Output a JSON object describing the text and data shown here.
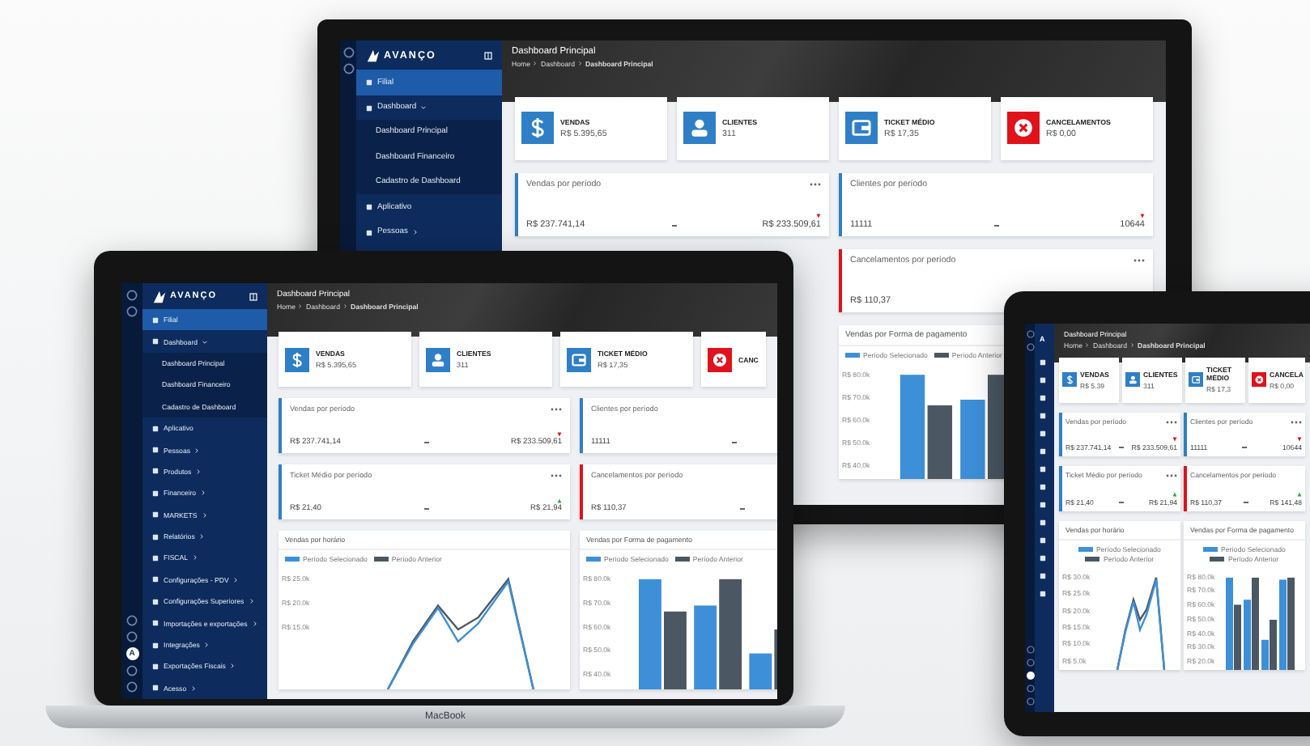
{
  "monitor": {
    "logo": "AVANÇO",
    "sidebar": [
      {
        "label": "Filial",
        "selected": true
      },
      {
        "label": "Dashboard",
        "selected": false,
        "expanded": true,
        "children": [
          {
            "label": "Dashboard Principal",
            "selected": false
          },
          {
            "label": "Dashboard Financeiro",
            "selected": false
          },
          {
            "label": "Cadastro de Dashboard",
            "selected": false
          }
        ]
      },
      {
        "label": "Aplicativo",
        "selected": false
      },
      {
        "label": "Pessoas",
        "selected": false,
        "expanded": false
      }
    ],
    "header": {
      "title": "Dashboard Principal",
      "breadcrumb": [
        "Home",
        "Dashboard",
        "Dashboard Principal"
      ]
    },
    "stats": [
      {
        "kind": "money",
        "title": "VENDAS",
        "value": "R$ 5.395,65"
      },
      {
        "kind": "user",
        "title": "CLIENTES",
        "value": "311"
      },
      {
        "kind": "wallet",
        "title": "TICKET MÉDIO",
        "value": "R$ 17,35"
      },
      {
        "kind": "cancel",
        "title": "CANCELAMENTOS",
        "value": "R$ 0,00"
      }
    ],
    "periods": [
      {
        "title": "Vendas por período",
        "color": "#2f7fc6",
        "menu": true,
        "current": {
          "value": "R$ 237.741,14"
        },
        "previous": {
          "value": "R$ 233.509,61",
          "rising": false
        }
      },
      {
        "title": "Clientes por período",
        "color": "#2f7fc6",
        "menu": false,
        "current": {
          "value": "11111"
        },
        "previous": {
          "value": "10644",
          "rising": false
        }
      }
    ],
    "right_column": {
      "periods": [
        {
          "title": "Cancelamentos por período",
          "color": "#e0121b",
          "menu": true,
          "current": {
            "value": "R$ 110,37"
          }
        }
      ],
      "charts": [
        {
          "title": "Vendas por Forma de pagamento",
          "kind": "bar",
          "legend": [
            {
              "label": "Período Selecionado",
              "color": "#3d8fd8"
            },
            {
              "label": "Período Anterior",
              "color": "#4b5863"
            }
          ],
          "y_axis_labels": [
            "R$ 80.0k",
            "R$ 70.0k",
            "R$ 60.0k",
            "R$ 50.0k",
            "R$ 40.0k"
          ]
        }
      ]
    }
  },
  "laptop": {
    "logo": "AVANÇO",
    "avatar_letter": "A",
    "brand": "MacBook",
    "sidebar": [
      {
        "label": "Filial",
        "selected": true
      },
      {
        "label": "Dashboard",
        "selected": false,
        "expanded": true,
        "children": [
          {
            "label": "Dashboard Principal",
            "selected": false
          },
          {
            "label": "Dashboard Financeiro",
            "selected": false
          },
          {
            "label": "Cadastro de Dashboard",
            "selected": false
          }
        ]
      },
      {
        "label": "Aplicativo",
        "selected": false
      },
      {
        "label": "Pessoas",
        "selected": false,
        "expanded": false
      },
      {
        "label": "Produtos",
        "selected": false,
        "expanded": false
      },
      {
        "label": "Financeiro",
        "selected": false,
        "expanded": false
      },
      {
        "label": "MARKETS",
        "selected": false,
        "expanded": false
      },
      {
        "label": "Relatórios",
        "selected": false,
        "expanded": false
      },
      {
        "label": "FISCAL",
        "selected": false,
        "expanded": false
      },
      {
        "label": "Configurações - PDV",
        "selected": false,
        "expanded": false
      },
      {
        "label": "Configurações Superiores",
        "selected": false,
        "expanded": false
      },
      {
        "label": "Importações e exportações",
        "selected": false,
        "expanded": false
      },
      {
        "label": "Integrações",
        "selected": false,
        "expanded": false
      },
      {
        "label": "Exportações Fiscais",
        "selected": false,
        "expanded": false
      },
      {
        "label": "Acesso",
        "selected": false,
        "expanded": false
      }
    ],
    "header": {
      "title": "Dashboard Principal",
      "breadcrumb": [
        "Home",
        "Dashboard",
        "Dashboard Principal"
      ]
    },
    "stats": [
      {
        "kind": "money",
        "title": "VENDAS",
        "value": "R$ 5.395,65"
      },
      {
        "kind": "user",
        "title": "CLIENTES",
        "value": "311"
      },
      {
        "kind": "wallet",
        "title": "TICKET MÉDIO",
        "value": "R$ 17,35"
      },
      {
        "kind": "cancel",
        "title": "CANC"
      }
    ],
    "periods": [
      {
        "title": "Vendas por período",
        "color": "#2f7fc6",
        "menu": true,
        "current": {
          "value": "R$ 237.741,14"
        },
        "previous": {
          "value": "R$ 233.509,61",
          "rising": false
        }
      },
      {
        "title": "Clientes por período",
        "color": "#2f7fc6",
        "menu": false,
        "current": {
          "value": "11111"
        }
      },
      {
        "title": "Ticket Médio por período",
        "color": "#2f7fc6",
        "menu": true,
        "current": {
          "value": "R$ 21,40"
        },
        "previous": {
          "value": "R$ 21,94",
          "rising": true
        }
      },
      {
        "title": "Cancelamentos por período",
        "color": "#e0121b",
        "menu": false,
        "current": {
          "value": "R$ 110,37"
        }
      }
    ],
    "charts": [
      {
        "title": "Vendas por horário",
        "kind": "line",
        "legend": [
          {
            "label": "Período Selecionado",
            "color": "#3d8fd8"
          },
          {
            "label": "Período Anterior",
            "color": "#4b5863"
          }
        ],
        "y_axis_labels": [
          "R$ 25.0k",
          "R$ 20.0k",
          "R$ 15.0k"
        ]
      },
      {
        "title": "Vendas por Forma de pagamento",
        "kind": "bar",
        "legend": [
          {
            "label": "Período Selecionado",
            "color": "#3d8fd8"
          },
          {
            "label": "Período Anterior",
            "color": "#4b5863"
          }
        ],
        "y_axis_labels": [
          "R$ 80.0k",
          "R$ 70.0k",
          "R$ 60.0k",
          "R$ 50.0k",
          "R$ 40.0k"
        ]
      }
    ]
  },
  "tablet": {
    "logo": "A",
    "header": {
      "title": "Dashboard Principal",
      "breadcrumb": [
        "Home",
        "Dashboard",
        "Dashboard Principal"
      ]
    },
    "stats": [
      {
        "kind": "money",
        "title": "VENDAS",
        "value": "R$ 5.39"
      },
      {
        "kind": "user",
        "title": "CLIENTES",
        "value": "311"
      },
      {
        "kind": "wallet",
        "title": "TICKET MÉDIO",
        "value": "R$ 17,3"
      },
      {
        "kind": "cancel",
        "title": "CANCELA",
        "value": "R$ 0,00"
      }
    ],
    "periods": [
      {
        "title": "Vendas por período",
        "color": "#2f7fc6",
        "menu": true,
        "current": {
          "value": "R$ 237.741,14"
        },
        "previous": {
          "value": "R$ 233.509,61",
          "rising": false
        }
      },
      {
        "title": "Clientes por período",
        "color": "#2f7fc6",
        "menu": true,
        "current": {
          "value": "11111"
        },
        "previous": {
          "value": "10644",
          "rising": false
        }
      },
      {
        "title": "Ticket Médio por período",
        "color": "#2f7fc6",
        "menu": true,
        "current": {
          "value": "R$ 21,40"
        },
        "previous": {
          "value": "R$ 21,94",
          "rising": true
        }
      },
      {
        "title": "Cancelamentos por período",
        "color": "#e0121b",
        "menu": false,
        "current": {
          "value": "R$ 110,37"
        },
        "previous": {
          "value": "R$ 141,48",
          "rising": true
        }
      }
    ],
    "charts": [
      {
        "title": "Vendas por horário",
        "kind": "line",
        "legend": [
          {
            "label": "Período Selecionado",
            "color": "#3d8fd8"
          },
          {
            "label": "Período Anterior",
            "color": "#4b5863"
          }
        ],
        "y_axis_labels": [
          "R$ 30.0k",
          "R$ 25.0k",
          "R$ 20.0k",
          "R$ 15.0k",
          "R$ 10.0k",
          "R$ 5.0k"
        ]
      },
      {
        "title": "Vendas por Forma de pagamento",
        "kind": "bar",
        "legend": [
          {
            "label": "Período Selecionado",
            "color": "#3d8fd8"
          },
          {
            "label": "Período Anterior",
            "color": "#4b5863"
          }
        ],
        "y_axis_labels": [
          "R$ 80.0k",
          "R$ 70.0k",
          "R$ 60.0k",
          "R$ 50.0k",
          "R$ 40.0k",
          "R$ 30.0k",
          "R$ 20.0k"
        ]
      }
    ]
  }
}
